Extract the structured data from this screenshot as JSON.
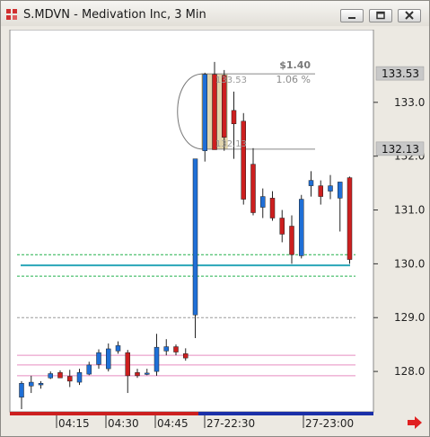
{
  "window": {
    "title": "S.MDVN - Medivation Inc, 3 Min",
    "buttons": [
      "minimize",
      "restore",
      "close"
    ]
  },
  "icons": {
    "app": "chart-app-icon",
    "minimize": "minimize-icon",
    "restore": "restore-icon",
    "close": "close-icon",
    "scroll": "right-arrow-icon"
  },
  "colors": {
    "up": "#1f6fd6",
    "down": "#cc1f1f",
    "price_line": "#2aa6b8",
    "green_line": "#22b14c",
    "pink_line": "#e88cc0",
    "gray_line": "#9a9a9a",
    "label_bg": "#c8c8c8"
  },
  "measure": {
    "change": "$1.40",
    "pct": "1.06 %",
    "top_price": "133.53",
    "bottom_price": "132.13"
  },
  "chart_data": {
    "type": "candlestick",
    "title": "S.MDVN - Medivation Inc, 3 Min",
    "ylim": [
      127.3,
      134.3
    ],
    "y_ticks": [
      "133.00",
      "132.00",
      "131.00",
      "130.00",
      "129.00",
      "128.00"
    ],
    "y_highlight_labels": [
      "133.53",
      "132.13"
    ],
    "x_tick_labels": [
      "04:15",
      "04:30",
      "04:45",
      "27-22:30",
      "27-23:00"
    ],
    "candles": [
      {
        "o": 127.52,
        "h": 127.82,
        "l": 127.3,
        "c": 127.78
      },
      {
        "o": 127.73,
        "h": 127.92,
        "l": 127.6,
        "c": 127.8
      },
      {
        "o": 127.75,
        "h": 127.82,
        "l": 127.68,
        "c": 127.78
      },
      {
        "o": 127.88,
        "h": 128.0,
        "l": 127.86,
        "c": 127.96
      },
      {
        "o": 127.98,
        "h": 128.02,
        "l": 127.9,
        "c": 127.88
      },
      {
        "o": 127.91,
        "h": 128.03,
        "l": 127.71,
        "c": 127.82
      },
      {
        "o": 127.8,
        "h": 128.05,
        "l": 127.75,
        "c": 127.98
      },
      {
        "o": 127.95,
        "h": 128.18,
        "l": 127.93,
        "c": 128.12
      },
      {
        "o": 128.13,
        "h": 128.41,
        "l": 128.05,
        "c": 128.35
      },
      {
        "o": 128.05,
        "h": 128.52,
        "l": 128.0,
        "c": 128.42
      },
      {
        "o": 128.38,
        "h": 128.56,
        "l": 128.33,
        "c": 128.48
      },
      {
        "o": 128.35,
        "h": 128.4,
        "l": 127.6,
        "c": 127.92
      },
      {
        "o": 127.98,
        "h": 128.05,
        "l": 127.88,
        "c": 127.92
      },
      {
        "o": 127.95,
        "h": 128.05,
        "l": 127.93,
        "c": 127.97
      },
      {
        "o": 128.0,
        "h": 128.7,
        "l": 127.92,
        "c": 128.45
      },
      {
        "o": 128.38,
        "h": 128.6,
        "l": 128.3,
        "c": 128.46
      },
      {
        "o": 128.46,
        "h": 128.5,
        "l": 128.3,
        "c": 128.36
      },
      {
        "o": 128.33,
        "h": 128.43,
        "l": 128.2,
        "c": 128.25
      },
      {
        "o": 129.05,
        "h": 129.28,
        "l": 128.62,
        "c": 131.95
      },
      {
        "o": 132.1,
        "h": 133.55,
        "l": 131.9,
        "c": 133.52
      },
      {
        "o": 133.52,
        "h": 133.75,
        "l": 132.85,
        "c": 132.12
      },
      {
        "o": 133.5,
        "h": 133.6,
        "l": 132.1,
        "c": 132.35
      },
      {
        "o": 132.85,
        "h": 133.2,
        "l": 131.95,
        "c": 132.6
      },
      {
        "o": 132.65,
        "h": 132.8,
        "l": 131.1,
        "c": 131.2
      },
      {
        "o": 131.85,
        "h": 132.15,
        "l": 130.9,
        "c": 130.95
      },
      {
        "o": 131.05,
        "h": 131.4,
        "l": 130.85,
        "c": 131.25
      },
      {
        "o": 131.22,
        "h": 131.35,
        "l": 130.8,
        "c": 130.85
      },
      {
        "o": 130.85,
        "h": 131.0,
        "l": 130.4,
        "c": 130.55
      },
      {
        "o": 130.7,
        "h": 130.9,
        "l": 130.0,
        "c": 130.17
      },
      {
        "o": 130.15,
        "h": 131.28,
        "l": 130.1,
        "c": 131.2
      },
      {
        "o": 131.45,
        "h": 131.72,
        "l": 131.25,
        "c": 131.55
      },
      {
        "o": 131.45,
        "h": 131.55,
        "l": 131.1,
        "c": 131.25
      },
      {
        "o": 131.35,
        "h": 131.65,
        "l": 131.2,
        "c": 131.45
      },
      {
        "o": 131.22,
        "h": 131.52,
        "l": 130.6,
        "c": 131.52
      },
      {
        "o": 131.6,
        "h": 131.62,
        "l": 130.0,
        "c": 130.08
      }
    ],
    "h_lines": [
      {
        "y": 130.17,
        "color": "green",
        "style": "dashed"
      },
      {
        "y": 129.97,
        "color": "teal",
        "style": "solid"
      },
      {
        "y": 129.77,
        "color": "green",
        "style": "dashed"
      },
      {
        "y": 129.0,
        "color": "gray",
        "style": "dashed"
      },
      {
        "y": 128.3,
        "color": "pink",
        "style": "solid"
      },
      {
        "y": 128.12,
        "color": "pink",
        "style": "solid"
      },
      {
        "y": 127.92,
        "color": "pink",
        "style": "solid"
      }
    ]
  }
}
